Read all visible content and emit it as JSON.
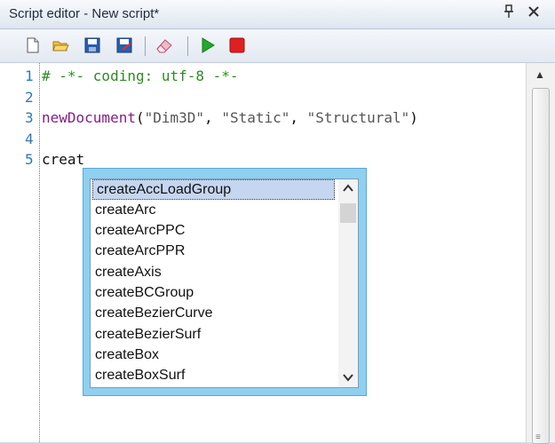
{
  "window": {
    "title": "Script editor - New script*",
    "pin_icon": "pin-icon",
    "close_icon": "close-icon"
  },
  "toolbar": {
    "icons": [
      "new-document-icon",
      "open-folder-icon",
      "save-icon",
      "save-as-icon",
      "clear-icon",
      "run-icon",
      "stop-icon"
    ],
    "colors": {
      "run": "#1faa2a",
      "stop": "#e02020"
    }
  },
  "editor": {
    "line_numbers": [
      "1",
      "2",
      "3",
      "4",
      "5"
    ],
    "lines": {
      "l1": "# -*- coding: utf-8 -*-",
      "l3_func": "newDocument",
      "l3_open": "(",
      "l3_arg1": "\"Dim3D\"",
      "l3_sep1": ", ",
      "l3_arg2": "\"Static\"",
      "l3_sep2": ", ",
      "l3_arg3": "\"Structural\"",
      "l3_close": ")",
      "l5": "creat"
    }
  },
  "autocomplete": {
    "items": [
      "createAccLoadGroup",
      "createArc",
      "createArcPPC",
      "createArcPPR",
      "createAxis",
      "createBCGroup",
      "createBezierCurve",
      "createBezierSurf",
      "createBox",
      "createBoxSurf"
    ],
    "selected": "createAccLoadGroup"
  }
}
